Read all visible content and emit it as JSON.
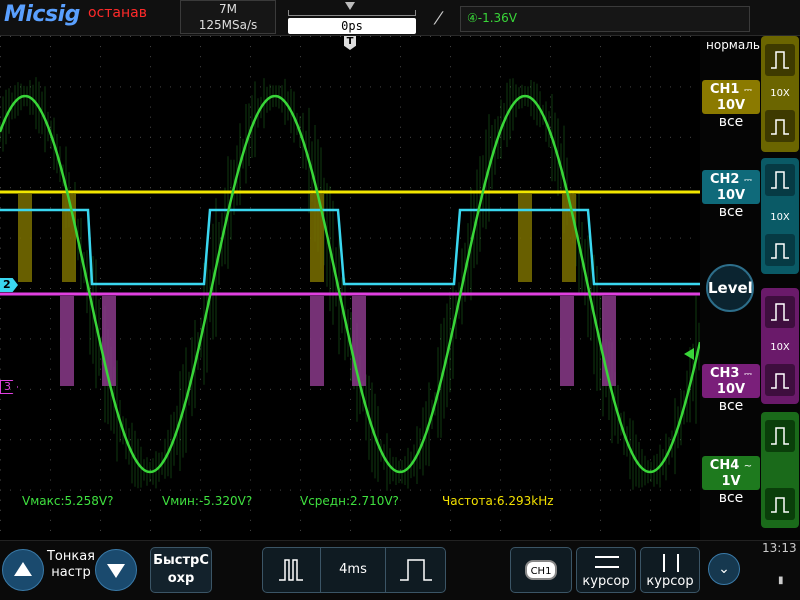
{
  "header": {
    "brand": "Micsig",
    "run_state": "останавить",
    "memory_depth": "7M",
    "sample_rate": "125MSa/s",
    "time_offset": "0ps",
    "trigger_source_level": "④-1.36V",
    "slope_icon": "rising-edge-icon"
  },
  "plot": {
    "markers": {
      "ch2": "2",
      "ch3": "3",
      "trigger_time": "T"
    },
    "measurements": {
      "vmax": "Vмакс:5.258V?",
      "vmin": "Vмин:-5.320V?",
      "vavg": "Vсредн:2.710V?",
      "freq": "Частота:6.293kHz"
    }
  },
  "colors": {
    "ch1": "#f2e600",
    "ch2": "#3ad7f0",
    "ch3": "#e040e0",
    "ch4": "#39d639"
  },
  "right_panel": {
    "trigger_mode": "нормаль",
    "level_label": "Level",
    "channels": [
      {
        "name": "CH1",
        "coupling": "⎓",
        "scale": "10V",
        "bandwidth": "все",
        "probe": "10X",
        "color": "#8b7a00"
      },
      {
        "name": "CH2",
        "coupling": "⎓",
        "scale": "10V",
        "bandwidth": "все",
        "probe": "10X",
        "color": "#0f6a7a"
      },
      {
        "name": "CH3",
        "coupling": "⎓",
        "scale": "10V",
        "bandwidth": "все",
        "probe": "10X",
        "color": "#7a1f7a"
      },
      {
        "name": "CH4",
        "coupling": "~",
        "scale": "1V",
        "bandwidth": "все",
        "probe": "",
        "color": "#1e7a1e"
      }
    ]
  },
  "bottom_bar": {
    "fine_label": "Тонкая настр",
    "quick_save": "БыстрС охр",
    "timebase": "4ms",
    "ch1_button": "CH1",
    "cursor_h": "курсор",
    "cursor_v": "курсор",
    "clock": "13:13"
  }
}
